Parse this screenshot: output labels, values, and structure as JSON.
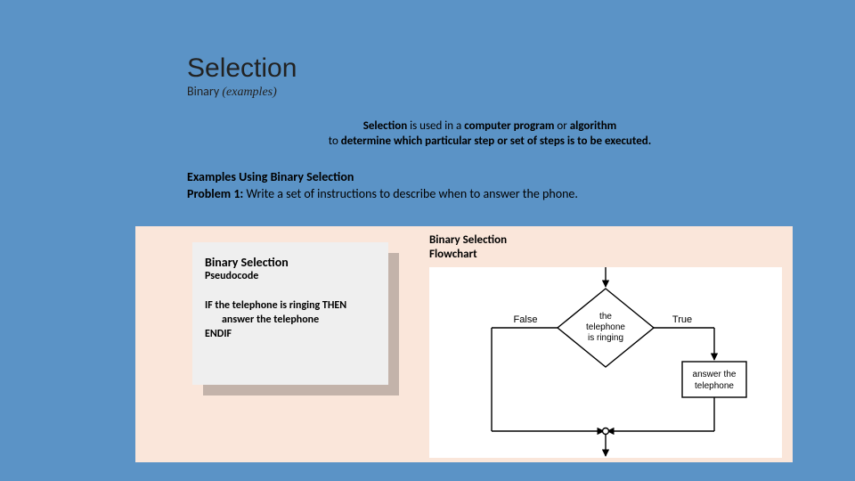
{
  "header": {
    "title": "Selection",
    "subtitle_main": "Binary",
    "subtitle_italic": "(examples)"
  },
  "definition": {
    "line1_b1": "Selection",
    "line1_mid": " is used in a ",
    "line1_b2": "computer program",
    "line1_mid2": " or ",
    "line1_b3": "algorithm",
    "line2_pre": "to ",
    "line2_b": "determine which particular step or set of steps is to be executed."
  },
  "examples": {
    "heading": "Examples Using Binary Selection",
    "problem_label": "Problem 1:",
    "problem_text": " Write a set of instructions to describe when to answer the phone."
  },
  "pseudo": {
    "title": "Binary Selection",
    "subtitle": "Pseudocode",
    "code": "IF the telephone is ringing THEN\n       answer the telephone\nENDIF"
  },
  "flowchart": {
    "label_line1": "Binary Selection",
    "label_line2": "Flowchart",
    "decision_line1": "the",
    "decision_line2": "telephone",
    "decision_line3": "is ringing",
    "false_label": "False",
    "true_label": "True",
    "action_line1": "answer the",
    "action_line2": "telephone"
  }
}
